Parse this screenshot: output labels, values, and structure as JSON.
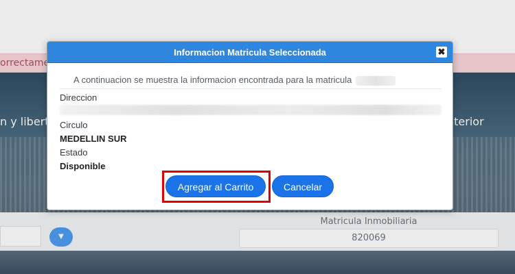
{
  "background": {
    "alert_text": "orrectame",
    "hero_left_text": "n y libert",
    "hero_right_text": "nterior",
    "matricula_label": "Matricula Inmobiliaria",
    "matricula_value": "820069",
    "dropdown_icon": "chevron-down-icon"
  },
  "modal": {
    "title": "Informacion Matricula Seleccionada",
    "close_glyph": "✖",
    "intro": "A continuacion se muestra la informacion encontrada para la matricula",
    "fields": {
      "direccion_label": "Direccion",
      "circulo_label": "Circulo",
      "circulo_value": "MEDELLIN SUR",
      "estado_label": "Estado",
      "estado_value": "Disponible"
    },
    "buttons": {
      "add_to_cart": "Agregar al Carrito",
      "cancel": "Cancelar"
    }
  },
  "colors": {
    "header_blue": "#2f86de",
    "button_blue": "#1a73e8",
    "highlight_red": "#e00000",
    "alert_pink": "#f9d6da"
  }
}
